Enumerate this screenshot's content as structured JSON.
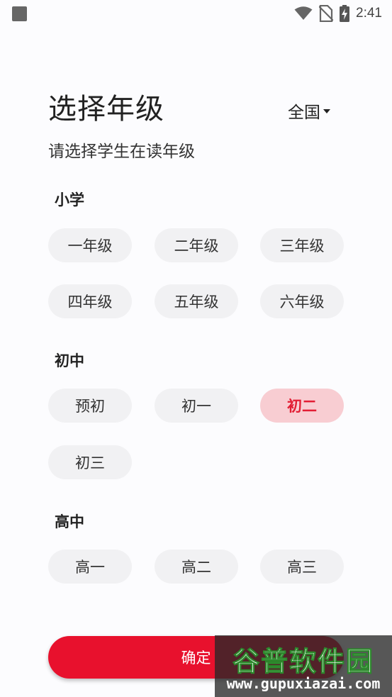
{
  "status_bar": {
    "time": "2:41"
  },
  "header": {
    "title": "选择年级",
    "region": "全国",
    "subtitle": "请选择学生在读年级"
  },
  "sections": [
    {
      "label": "小学",
      "grades": [
        "一年级",
        "二年级",
        "三年级",
        "四年级",
        "五年级",
        "六年级"
      ]
    },
    {
      "label": "初中",
      "grades": [
        "预初",
        "初一",
        "初二",
        "初三"
      ]
    },
    {
      "label": "高中",
      "grades": [
        "高一",
        "高二",
        "高三"
      ]
    }
  ],
  "selected_grade": "初二",
  "confirm_label": "确定",
  "watermark": {
    "title": "谷普软件园",
    "url": "www.gupuxiazai.com"
  },
  "colors": {
    "accent": "#e8112d",
    "selected_bg": "#f8cdd2",
    "selected_text": "#e21e34",
    "chip_bg": "#f1f1f3"
  }
}
